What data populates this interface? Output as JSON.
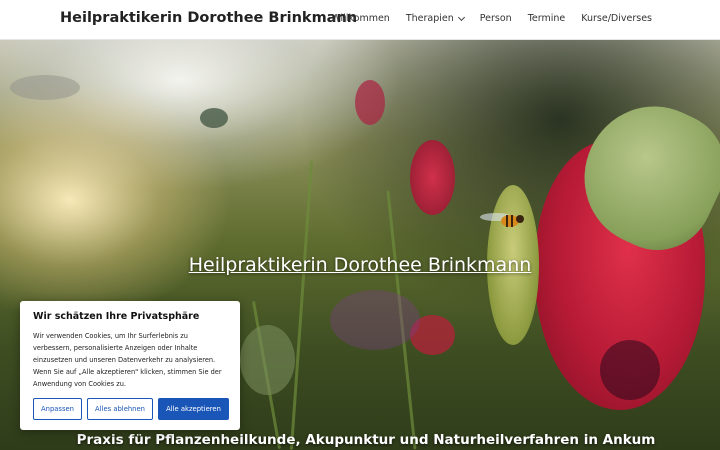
{
  "header": {
    "site_title": "Heilpraktikerin Dorothee Brinkmann",
    "nav": [
      {
        "label": "Willkommen"
      },
      {
        "label": "Therapien",
        "has_dropdown": true
      },
      {
        "label": "Person"
      },
      {
        "label": "Termine"
      },
      {
        "label": "Kurse/Diverses"
      }
    ]
  },
  "hero": {
    "title": "Heilpraktikerin Dorothee Brinkmann",
    "subtitle": "Praxis für Pflanzenheilkunde, Akupunktur und Naturheilverfahren in Ankum"
  },
  "cookie_banner": {
    "title": "Wir schätzen Ihre Privatsphäre",
    "text": "Wir verwenden Cookies, um Ihr Surferlebnis zu verbessern, personalisierte Anzeigen oder Inhalte einzusetzen und unseren Datenverkehr zu analysieren. Wenn Sie auf „Alle akzeptieren\" klicken, stimmen Sie der Anwendung von Cookies zu.",
    "buttons": {
      "customize": "Anpassen",
      "reject": "Alles ablehnen",
      "accept": "Alle akzeptieren"
    }
  },
  "colors": {
    "accent": "#1a56b8",
    "header_bg": "#ffffff"
  }
}
